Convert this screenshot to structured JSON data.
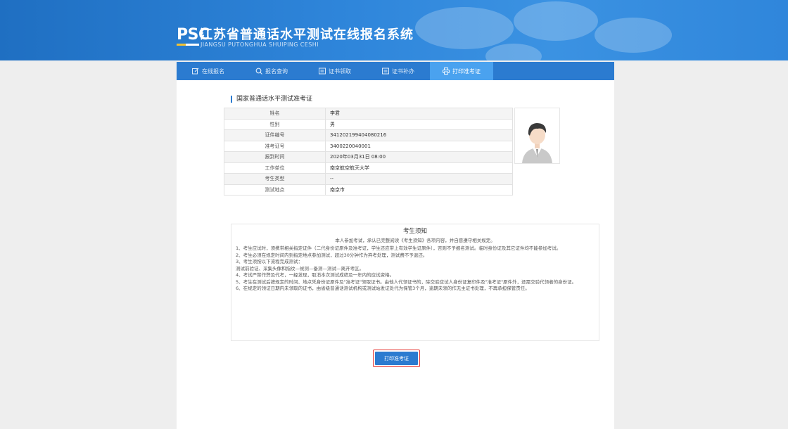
{
  "header": {
    "logo_text": "PSC",
    "title_cn": "江苏省普通话水平测试在线报名系统",
    "title_en": "JIANGSU PUTONGHUA SHUIPING CESHI"
  },
  "nav": [
    {
      "label": "在线报名",
      "icon": "edit-icon"
    },
    {
      "label": "报名查询",
      "icon": "search-icon"
    },
    {
      "label": "证书领取",
      "icon": "certificate-icon"
    },
    {
      "label": "证书补办",
      "icon": "certificate-icon"
    },
    {
      "label": "打印准考证",
      "icon": "printer-icon"
    }
  ],
  "active_nav": 4,
  "section_title": "国家普通话水平测试准考证",
  "info": [
    {
      "label": "姓名",
      "value": "李君"
    },
    {
      "label": "性别",
      "value": "男"
    },
    {
      "label": "证件编号",
      "value": "341202199404080216"
    },
    {
      "label": "准考证号",
      "value": "3400220040001"
    },
    {
      "label": "报到时间",
      "value": "2020年03月31日 08:00"
    },
    {
      "label": "工作单位",
      "value": "南京航空航天大学"
    },
    {
      "label": "考生类型",
      "value": "--"
    },
    {
      "label": "测试地点",
      "value": "南京市"
    }
  ],
  "notice": {
    "heading": "考生须知",
    "subheading": "本人参加考试，承认已完整阅读《考生须知》各项内容，并自愿遵守相关规定。",
    "items": [
      "1、考生应试时，须携带相关指定证件（二代身份证原件及准考证，学生还应带上有效学生证原件），否则不予报名测试。临时身份证及其它证件均不能参加考试。",
      "2、考生必须在规定时间内到指定地点参加测试，超过30分钟作为弃考处理，测试费不予退还。",
      "3、考生须按以下流程完成测试：",
      "测试前验证、采集头像和指纹—候测—备测—测试—离开考区。",
      "4、考试严禁作弊及代考，一经发现，取消本次测试成绩及一年内的应试资格。",
      "5、考生在测试后按规定的时间、地点凭身份证原件及\"准考证\"领取证书。由他人代领证书的，除交验应试人身份证复印件及\"准考证\"原件外，还需交验代领者的身份证。",
      "6、在规定的领证日期内未领取的证书，由省级普通话测试机构或测试站发证处代为保管3个月，逾期未领的作无主证书处理，不再承担保管责任。"
    ]
  },
  "print_button": "打印准考证",
  "colors": {
    "primary": "#2b7bd0",
    "active_tab": "#4aa2ef",
    "highlight": "#e53935"
  }
}
